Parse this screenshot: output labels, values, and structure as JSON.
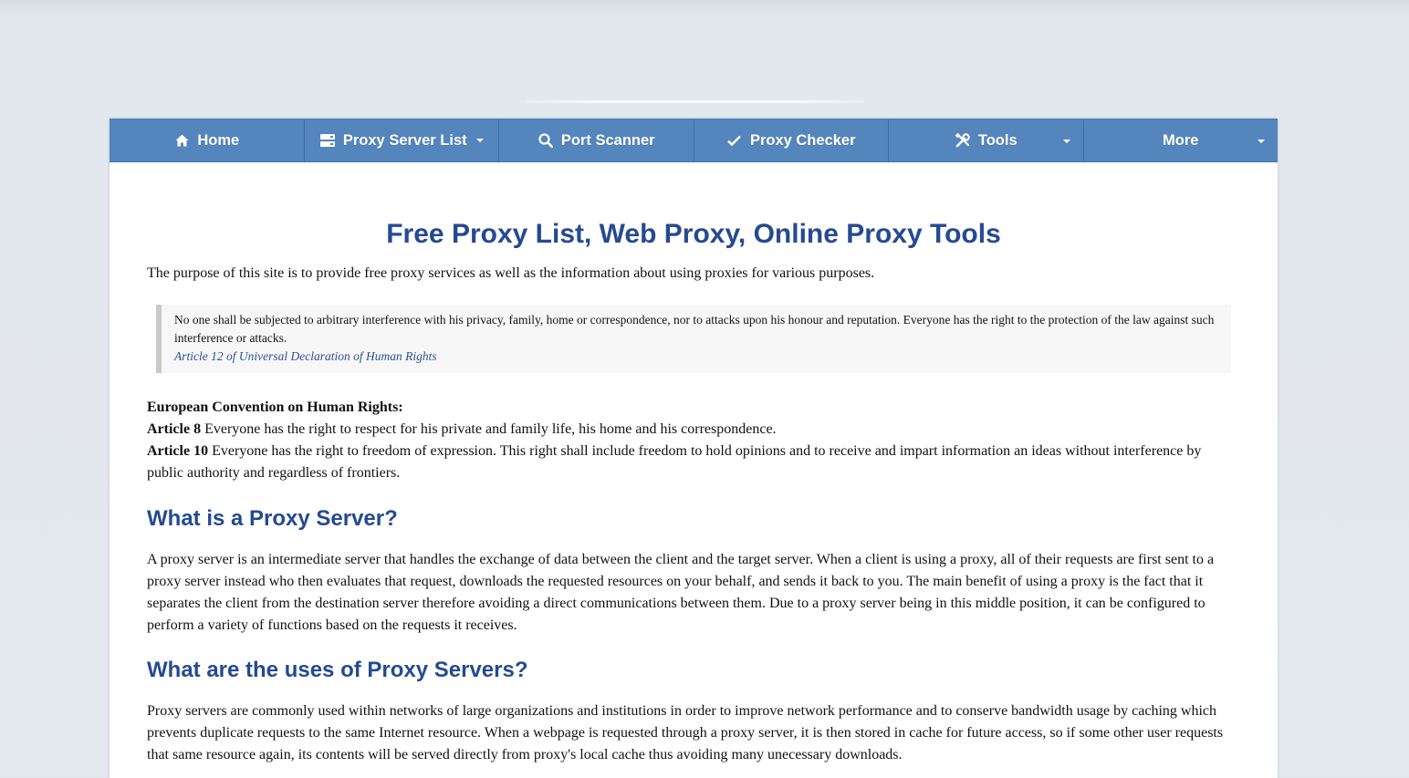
{
  "nav": {
    "items": [
      {
        "label": "Home",
        "icon": "home-icon",
        "dropdown": false
      },
      {
        "label": "Proxy Server List",
        "icon": "server-list-icon",
        "dropdown": true
      },
      {
        "label": "Port Scanner",
        "icon": "search-icon",
        "dropdown": false
      },
      {
        "label": "Proxy Checker",
        "icon": "checkmark-icon",
        "dropdown": false
      },
      {
        "label": "Tools",
        "icon": "tools-icon",
        "dropdown": true
      },
      {
        "label": "More",
        "icon": "",
        "dropdown": true
      }
    ]
  },
  "page": {
    "title": "Free Proxy List, Web Proxy, Online Proxy Tools",
    "intro": "The purpose of this site is to provide free proxy services as well as the information about using proxies for various purposes.",
    "quote": {
      "text": "No one shall be subjected to arbitrary interference with his privacy, family, home or correspondence, nor to attacks upon his honour and reputation. Everyone has the right to the protection of the law against such interference or attacks.",
      "cite": "Article 12 of Universal Declaration of Human Rights"
    },
    "echr": {
      "heading": "European Convention on Human Rights:",
      "articles": [
        {
          "label": "Article 8",
          "text": " Everyone has the right to respect for his private and family life, his home and his correspondence."
        },
        {
          "label": "Article 10",
          "text": " Everyone has the right to freedom of expression. This right shall include freedom to hold opinions and to receive and impart information an ideas without interference by public authority and regardless of frontiers."
        }
      ]
    },
    "sections": [
      {
        "heading": "What is a Proxy Server?",
        "body": "A proxy server is an intermediate server that handles the exchange of data between the client and the target server. When a client is using a proxy, all of their requests are first sent to a proxy server instead who then evaluates that request, downloads the requested resources on your behalf, and sends it back to you. The main benefit of using a proxy is the fact that it separates the client from the destination server therefore avoiding a direct communications between them. Due to a proxy server being in this middle position, it can be configured to perform a variety of functions based on the requests it receives."
      },
      {
        "heading": "What are the uses of Proxy Servers?",
        "body": "Proxy servers are commonly used within networks of large organizations and institutions in order to improve network performance and to conserve bandwidth usage by caching which prevents duplicate requests to the same Internet resource. When a webpage is requested through a proxy server, it is then stored in cache for future access, so if some other user requests that same resource again, its contents will be served directly from proxy's local cache thus avoiding many unecessary downloads."
      }
    ]
  },
  "colors": {
    "nav_bg": "#5485bd",
    "heading": "#254a92",
    "link": "#2d4e9b"
  }
}
